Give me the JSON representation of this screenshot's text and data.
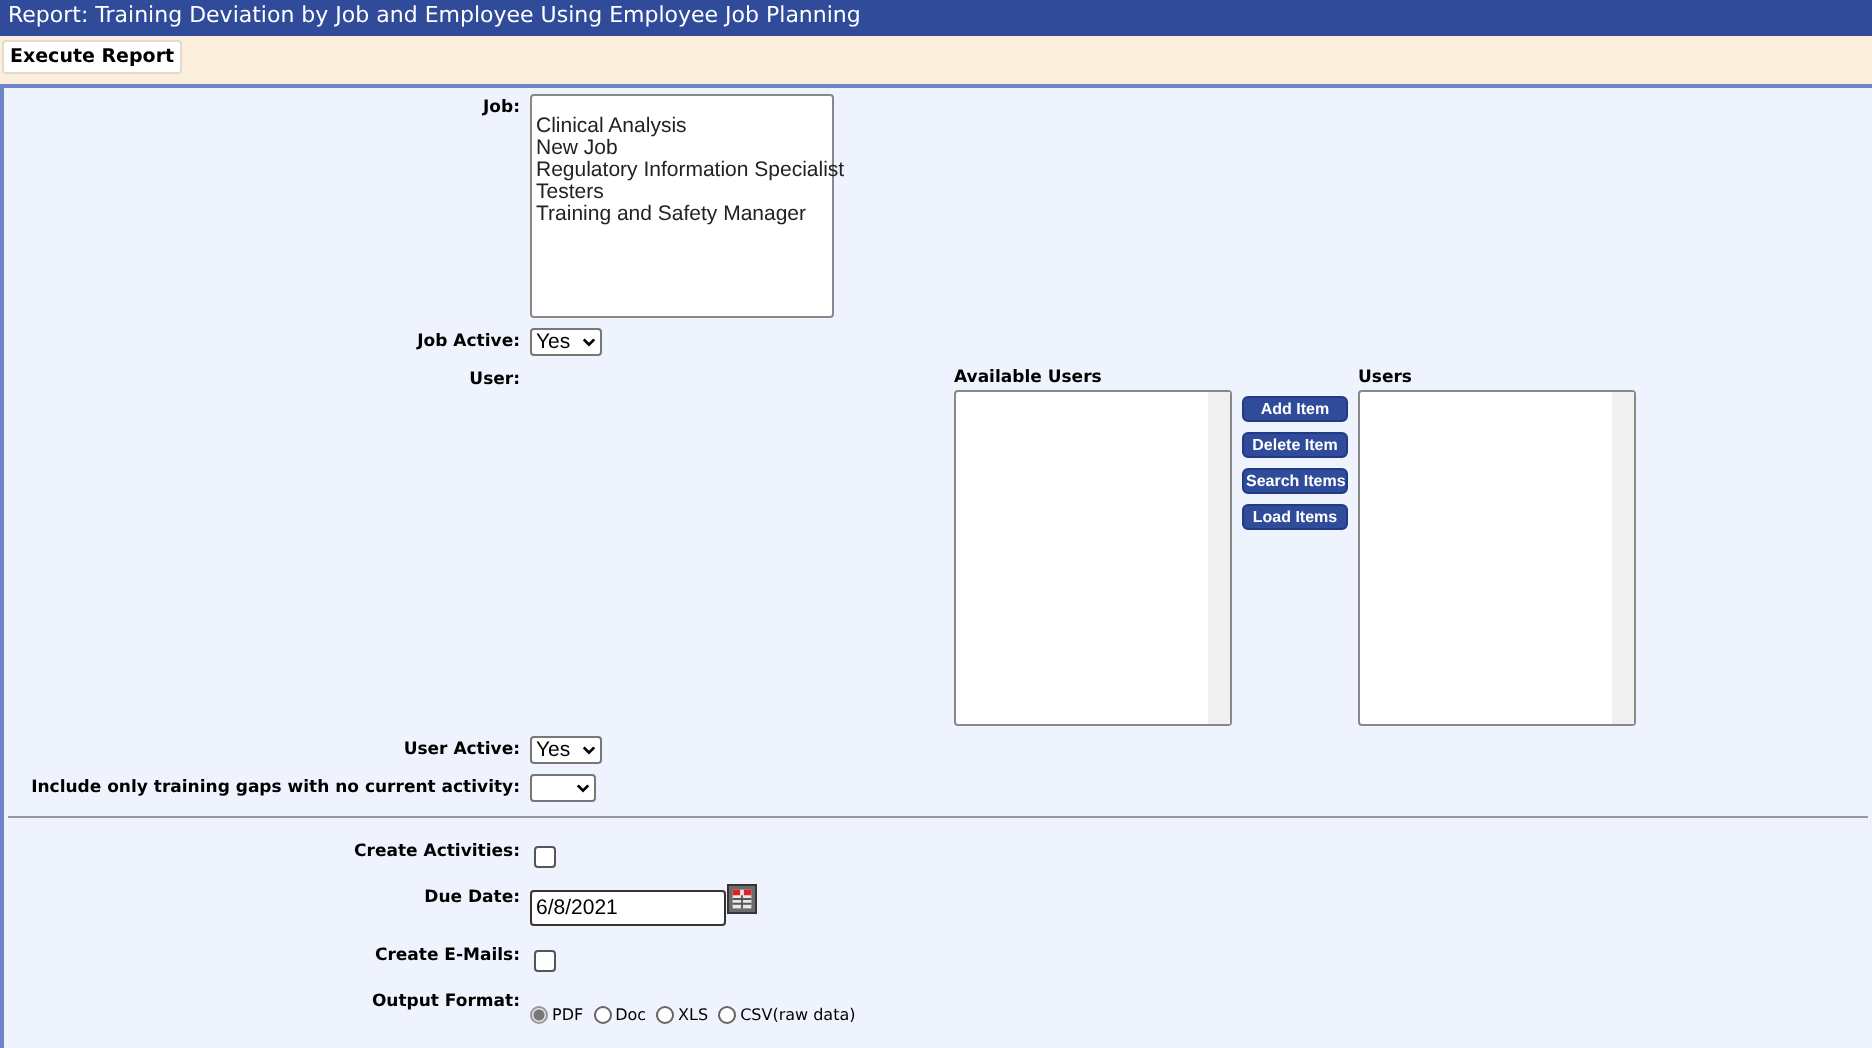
{
  "window": {
    "title": "Report: Training Deviation by Job and Employee Using Employee Job Planning"
  },
  "toolbar": {
    "execute_button": "Execute Report"
  },
  "job": {
    "label": "Job:",
    "options": [
      "Clinical Analysis",
      "New Job",
      "Regulatory Information Specialist",
      "Testers",
      "Training and Safety Manager"
    ]
  },
  "job_active": {
    "label": "Job Active:",
    "value": "Yes"
  },
  "user": {
    "label": "User:",
    "available_heading": "Available Users",
    "users_heading": "Users",
    "buttons": [
      "Add Item",
      "Delete Item",
      "Search Items",
      "Load Items"
    ]
  },
  "user_active": {
    "label": "User Active:",
    "value": "Yes"
  },
  "gaps_only": {
    "label": "Include only training gaps with no current activity:"
  },
  "create_activities": {
    "label": "Create Activities:",
    "checked": false
  },
  "due_date": {
    "label": "Due Date:",
    "value": "6/8/2021"
  },
  "create_emails": {
    "label": "Create E-Mails:",
    "checked": false
  },
  "output_format": {
    "label": "Output Format:",
    "options": [
      {
        "label": "PDF",
        "selected": true
      },
      {
        "label": "Doc",
        "selected": false
      },
      {
        "label": "XLS",
        "selected": false
      },
      {
        "label": "CSV(raw data)",
        "selected": false
      }
    ]
  }
}
